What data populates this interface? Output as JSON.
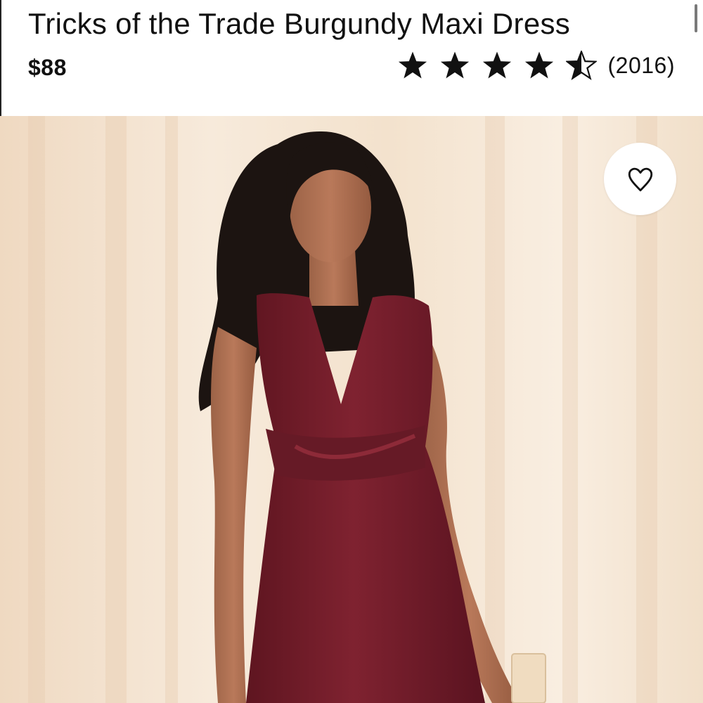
{
  "product": {
    "title": "Tricks of the Trade Burgundy Maxi Dress",
    "price": "$88",
    "rating": {
      "value": 4.5,
      "max": 5,
      "review_count": "(2016)"
    }
  },
  "image": {
    "description_icon": "product-photo",
    "favorite_icon": "heart-icon"
  },
  "colors": {
    "text": "#111111",
    "dress": "#7a1f2b",
    "background": "#f3e3cf"
  }
}
